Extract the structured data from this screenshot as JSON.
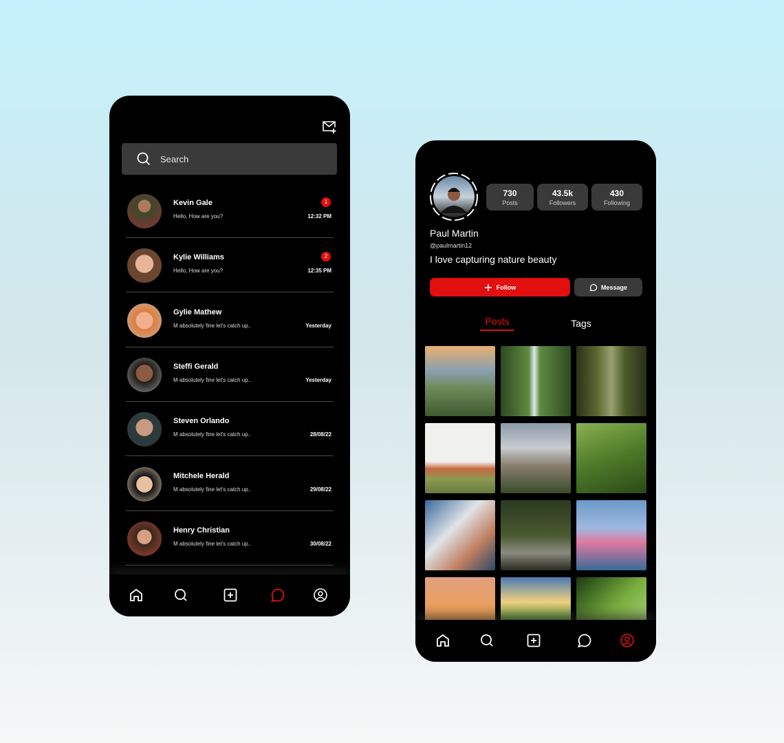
{
  "messages_screen": {
    "search_placeholder": "Search",
    "conversations": [
      {
        "name": "Kevin Gale",
        "message": "Hello, How are you?",
        "time": "12:32 PM",
        "unread": "1"
      },
      {
        "name": "Kylie Williams",
        "message": "Hello, How are you?",
        "time": "12:35 PM",
        "unread": "2"
      },
      {
        "name": "Gylie Mathew",
        "message": "M absolutely fine let's catch up..",
        "time": "Yesterday"
      },
      {
        "name": "Steffi Gerald",
        "message": "M absolutely fine let's catch up..",
        "time": "Yesterday"
      },
      {
        "name": "Steven Orlando",
        "message": "M absolutely fine let's catch up..",
        "time": "28/08/22"
      },
      {
        "name": "Mitchele Herald",
        "message": "M absolutely fine let's catch up..",
        "time": "29/08/22"
      },
      {
        "name": "Henry Christian",
        "message": "M absolutely fine let's catch up..",
        "time": "30/08/22"
      }
    ],
    "active_nav": "messages"
  },
  "profile_screen": {
    "name": "Paul Martin",
    "handle": "@paulmartin12",
    "bio": "I love capturing nature beauty",
    "stats": [
      {
        "value": "730",
        "label": "Posts"
      },
      {
        "value": "43.5k",
        "label": "Followers"
      },
      {
        "value": "430",
        "label": "Following"
      }
    ],
    "follow_label": "Follow",
    "message_label": "Message",
    "tabs": [
      {
        "label": "Posts",
        "active": true
      },
      {
        "label": "Tags",
        "active": false
      }
    ],
    "active_nav": "profile"
  },
  "colors": {
    "accent": "#e20f0f",
    "surface": "#3a3a3a",
    "background": "#000000"
  }
}
